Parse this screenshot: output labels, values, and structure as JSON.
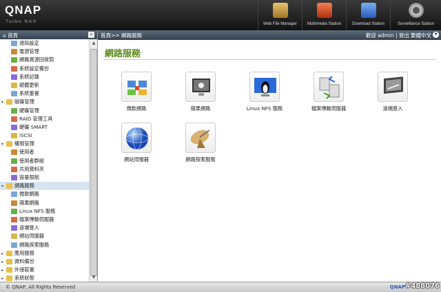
{
  "header": {
    "logo": "QNAP",
    "logo_sub": "Turbo NAS",
    "apps": [
      {
        "label": "Web File Manager",
        "color": "#c8a24a"
      },
      {
        "label": "Multimedia Station",
        "color": "#d94f2a"
      },
      {
        "label": "Download Station",
        "color": "#3a7ad8"
      },
      {
        "label": "Surveillance Station",
        "color": "#9aa0a8"
      }
    ]
  },
  "sidebar": {
    "title": "首頁",
    "collapse": "«",
    "items": [
      {
        "label": "通知設定",
        "level": 1
      },
      {
        "label": "電源管理",
        "level": 1
      },
      {
        "label": "網路資源回收筒",
        "level": 1
      },
      {
        "label": "系統設定備份",
        "level": 1
      },
      {
        "label": "系統記錄",
        "level": 1
      },
      {
        "label": "韌體更新",
        "level": 1
      },
      {
        "label": "系統重置",
        "level": 1
      },
      {
        "label": "磁碟管理",
        "level": 0,
        "toggle": "▾"
      },
      {
        "label": "硬碟管理",
        "level": 1
      },
      {
        "label": "RAID 管理工具",
        "level": 1
      },
      {
        "label": "硬碟 SMART",
        "level": 1
      },
      {
        "label": "iSCSI",
        "level": 1
      },
      {
        "label": "權限管理",
        "level": 0,
        "toggle": "▾"
      },
      {
        "label": "使用者",
        "level": 1
      },
      {
        "label": "使用者群組",
        "level": 1
      },
      {
        "label": "共用資料夾",
        "level": 1
      },
      {
        "label": "容量限制",
        "level": 1
      },
      {
        "label": "網路服務",
        "level": 0,
        "toggle": "▾",
        "selected": true
      },
      {
        "label": "微軟網路",
        "level": 1
      },
      {
        "label": "蘋果網路",
        "level": 1
      },
      {
        "label": "Linux NFS 服務",
        "level": 1
      },
      {
        "label": "檔案傳輸伺服器",
        "level": 1
      },
      {
        "label": "遠端登入",
        "level": 1
      },
      {
        "label": "網站伺服器",
        "level": 1
      },
      {
        "label": "網路探索服務",
        "level": 1
      },
      {
        "label": "應用服務",
        "level": 0,
        "toggle": "▸"
      },
      {
        "label": "資料備份",
        "level": 0,
        "toggle": "▸"
      },
      {
        "label": "外接裝置",
        "level": 0,
        "toggle": "▸"
      },
      {
        "label": "系統狀態",
        "level": 0,
        "toggle": "▸"
      }
    ]
  },
  "topbar": {
    "breadcrumb": "首頁>> 網路服務",
    "user": "歡迎 admin | 登出",
    "language": "繁體中文"
  },
  "main": {
    "title": "網路服務",
    "tiles": [
      {
        "label": "微軟網路",
        "icon": "windows-network-icon"
      },
      {
        "label": "蘋果網路",
        "icon": "apple-network-icon"
      },
      {
        "label": "Linux NFS 服務",
        "icon": "linux-nfs-icon"
      },
      {
        "label": "檔案傳輸伺服器",
        "icon": "ftp-server-icon"
      },
      {
        "label": "遠端登入",
        "icon": "remote-login-icon"
      },
      {
        "label": "網站伺服器",
        "icon": "web-server-icon"
      },
      {
        "label": "網路探索服務",
        "icon": "network-discovery-icon"
      }
    ]
  },
  "footer": {
    "copyright": "© QNAP, All Rights Reserved",
    "brand": "QNAP",
    "tag": "#488076"
  }
}
